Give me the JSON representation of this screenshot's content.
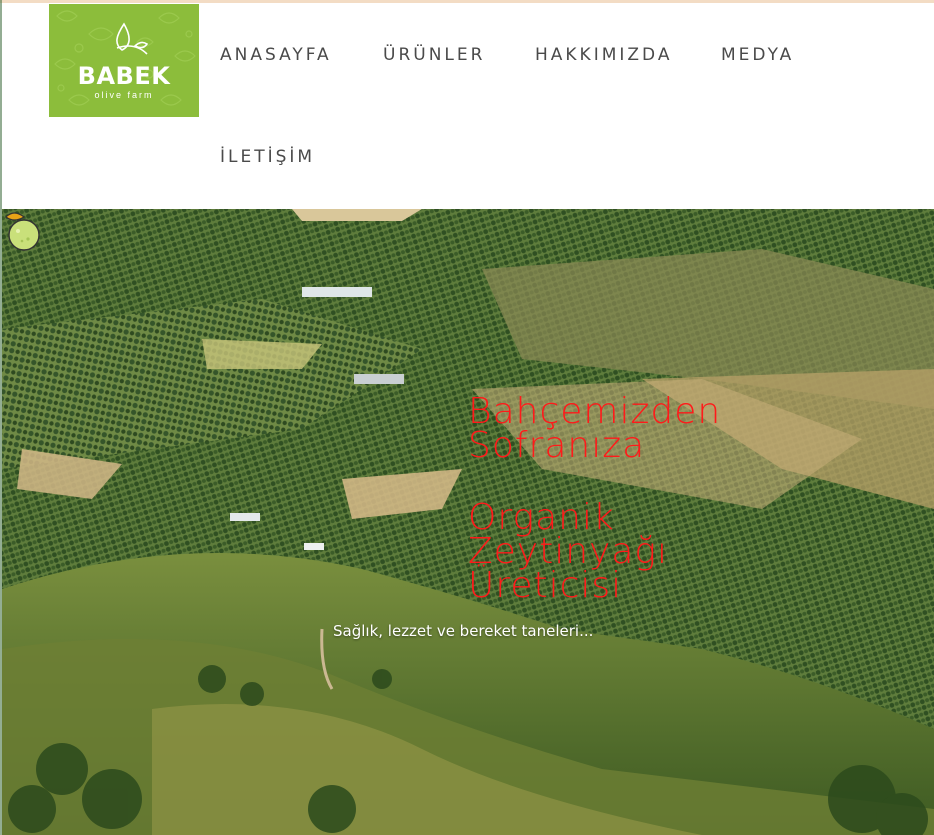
{
  "brand": {
    "name": "BABEK",
    "tagline": "olive farm",
    "color": "#8cbd3b"
  },
  "nav": {
    "items": [
      {
        "label": "ANASAYFA"
      },
      {
        "label": "ÜRÜNLER"
      },
      {
        "label": "HAKKIMIZDA"
      },
      {
        "label": "MEDYA"
      },
      {
        "label": "İLETİŞİM"
      }
    ]
  },
  "hero": {
    "title_lines": [
      "Bahçemizden",
      "Sofranıza"
    ],
    "subtitle_lines": [
      "Organik",
      "Zeytinyağı",
      "Üreticisi"
    ],
    "tagline": "Sağlık, lezzet ve bereket taneleri...",
    "title_color": "#ff1a1a",
    "icon": "olive-icon"
  }
}
